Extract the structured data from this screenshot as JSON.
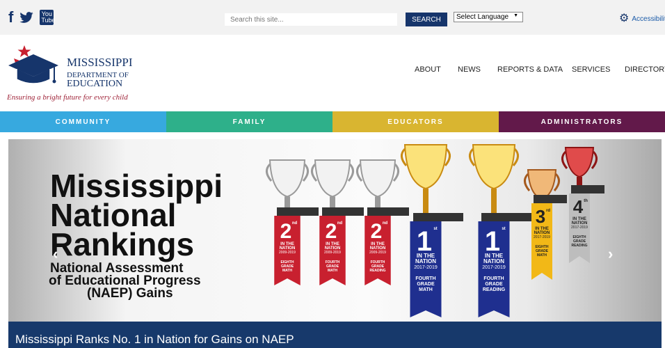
{
  "topbar": {
    "social": [
      {
        "icon": "facebook-icon",
        "glyph": "f"
      },
      {
        "icon": "twitter-icon",
        "glyph": "🐦"
      },
      {
        "icon": "youtube-icon",
        "glyph": "You Tube"
      }
    ],
    "search_placeholder": "Search this site...",
    "search_button": "SEARCH",
    "language_select": "Select Language",
    "accessibility": "Accessibility"
  },
  "logo": {
    "line1": "MISSISSIPPI",
    "line2": "DEPARTMENT OF",
    "line3": "EDUCATION",
    "tagline": "Ensuring a bright future for every child"
  },
  "nav": [
    "ABOUT",
    "NEWS",
    "REPORTS & DATA",
    "SERVICES",
    "DIRECTORY"
  ],
  "categories": [
    {
      "label": "COMMUNITY",
      "color": "#37a9df"
    },
    {
      "label": "FAMILY",
      "color": "#2eb08a"
    },
    {
      "label": "EDUCATORS",
      "color": "#d9b530"
    },
    {
      "label": "ADMINISTRATORS",
      "color": "#62194a"
    }
  ],
  "hero": {
    "title_lines": [
      "Mississippi",
      "National",
      "Rankings"
    ],
    "subtitle_lines": [
      "National Assessment",
      "of Educational Progress",
      "(NAEP) Gains"
    ],
    "caption": "Mississippi Ranks No. 1 in Nation for Gains on NAEP",
    "trophies": [
      {
        "rank": "2",
        "suffix": "nd",
        "years": "2009-2019",
        "subject": "EIGHTH GRADE MATH",
        "ribbon": "#c8202f",
        "cup": "silver"
      },
      {
        "rank": "2",
        "suffix": "nd",
        "years": "2009-2019",
        "subject": "FOURTH GRADE MATH",
        "ribbon": "#c8202f",
        "cup": "silver"
      },
      {
        "rank": "2",
        "suffix": "nd",
        "years": "2009-2019",
        "subject": "FOURTH GRADE READING",
        "ribbon": "#c8202f",
        "cup": "silver"
      },
      {
        "rank": "1",
        "suffix": "st",
        "years": "2017-2019",
        "subject": "FOURTH GRADE MATH",
        "ribbon": "#1f2f8f",
        "cup": "gold"
      },
      {
        "rank": "1",
        "suffix": "st",
        "years": "2017-2019",
        "subject": "FOURTH GRADE READING",
        "ribbon": "#1f2f8f",
        "cup": "gold"
      },
      {
        "rank": "3",
        "suffix": "rd",
        "years": "2017-2019",
        "subject": "EIGHTH GRADE MATH",
        "ribbon": "#f2b817",
        "cup": "bronze"
      },
      {
        "rank": "4",
        "suffix": "th",
        "years": "2017-2019",
        "subject": "EIGHTH GRADE READING",
        "ribbon": "#bdbdbd",
        "cup": "red"
      }
    ],
    "in_the_nation": "IN THE NATION"
  }
}
